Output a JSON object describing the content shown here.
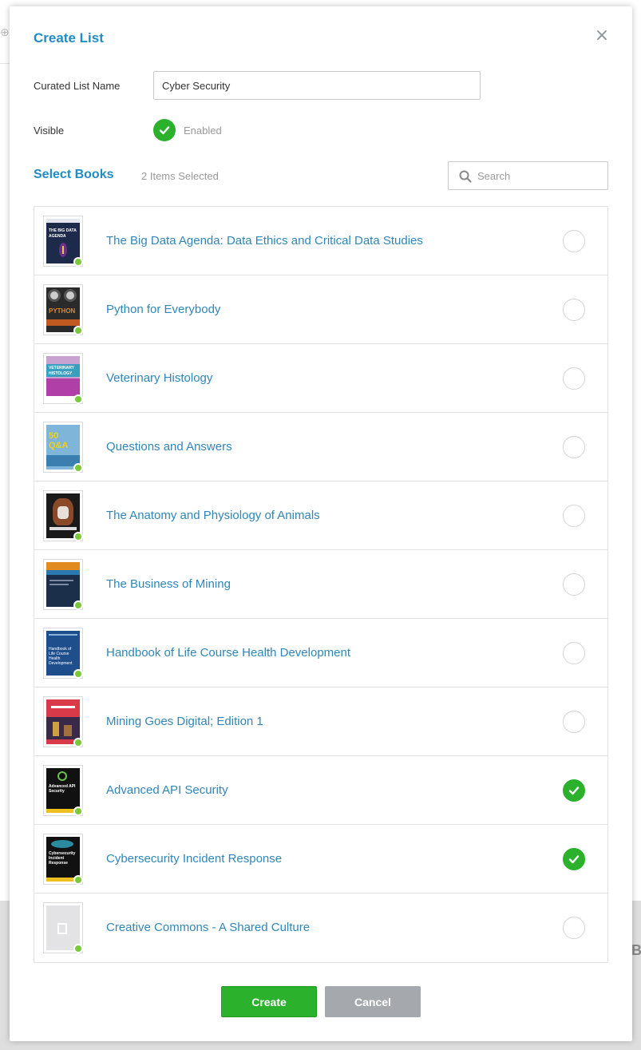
{
  "modal": {
    "title": "Create List",
    "close_symbol": "×"
  },
  "form": {
    "name_label": "Curated List Name",
    "name_value": "Cyber Security",
    "visible_label": "Visible",
    "visible_status": "Enabled"
  },
  "books_section": {
    "title": "Select Books",
    "selected_count": "2 Items Selected",
    "search_placeholder": "Search"
  },
  "books": [
    {
      "title": "The Big Data Agenda: Data Ethics and Critical Data Studies",
      "selected": false,
      "cover_text": "THE BIG DATA AGENDA"
    },
    {
      "title": "Python for Everybody",
      "selected": false,
      "cover_text": "PYTHON"
    },
    {
      "title": "Veterinary Histology",
      "selected": false,
      "cover_text": "VETERINARY HISTOLOGY"
    },
    {
      "title": "Questions and Answers",
      "selected": false,
      "cover_text": "50 Q&A"
    },
    {
      "title": "The Anatomy and Physiology of Animals",
      "selected": false,
      "cover_text": ""
    },
    {
      "title": "The Business of Mining",
      "selected": false,
      "cover_text": ""
    },
    {
      "title": "Handbook of Life Course Health Development",
      "selected": false,
      "cover_text": "Handbook of Life Course Health Development"
    },
    {
      "title": "Mining Goes Digital; Edition 1",
      "selected": false,
      "cover_text": ""
    },
    {
      "title": "Advanced API Security",
      "selected": true,
      "cover_text": "Advanced API Security"
    },
    {
      "title": "Cybersecurity Incident Response",
      "selected": true,
      "cover_text": "Cybersecurity Incident Response"
    },
    {
      "title": "Creative Commons - A Shared Culture",
      "selected": false,
      "cover_text": ""
    }
  ],
  "actions": {
    "create_label": "Create",
    "cancel_label": "Cancel"
  },
  "colors": {
    "accent": "#1f8dc4",
    "link": "#2f86b8",
    "success": "#2bb12b",
    "available_dot": "#79c93a",
    "cancel": "#a5a9ad"
  },
  "icons": {
    "close": "close-icon",
    "visible": "checkmark-icon",
    "search": "search-icon",
    "selected": "checkmark-icon",
    "available": "available-dot-icon"
  }
}
